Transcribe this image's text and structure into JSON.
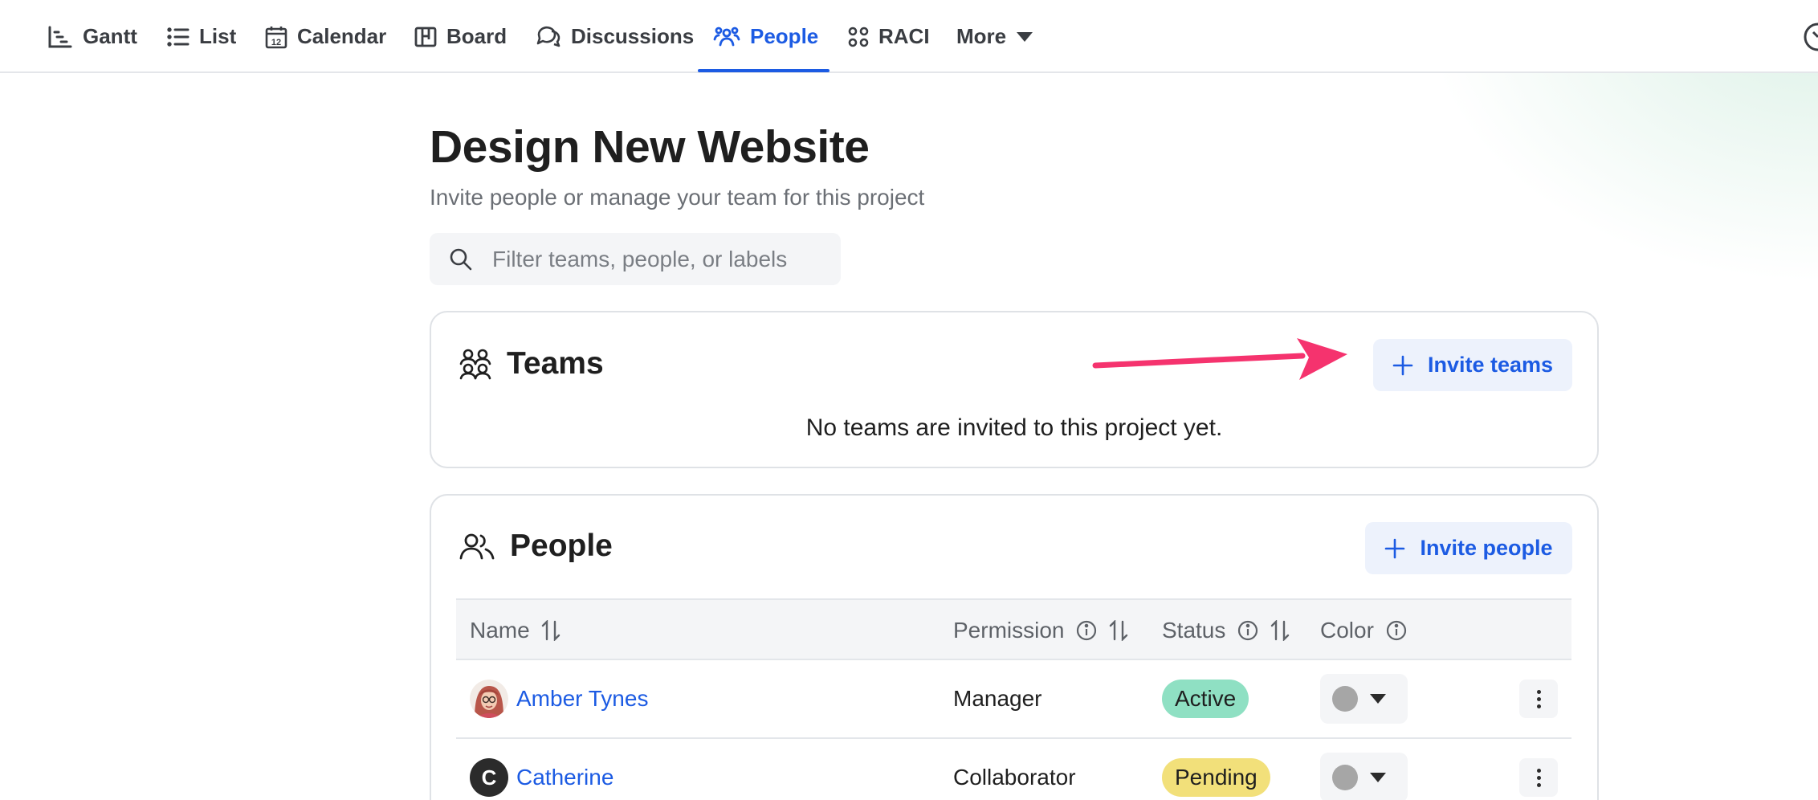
{
  "nav": {
    "items": [
      {
        "label": "Gantt",
        "icon": "gantt-icon"
      },
      {
        "label": "List",
        "icon": "list-icon"
      },
      {
        "label": "Calendar",
        "icon": "calendar-icon"
      },
      {
        "label": "Board",
        "icon": "board-icon"
      },
      {
        "label": "Discussions",
        "icon": "discussions-icon"
      },
      {
        "label": "People",
        "icon": "people-icon",
        "active": true
      },
      {
        "label": "RACI",
        "icon": "raci-icon"
      },
      {
        "label": "More",
        "icon": "caret-down-icon"
      }
    ],
    "right_icon": "timer-icon",
    "calendar_icon_day": "12"
  },
  "header": {
    "title": "Design New Website",
    "subtitle": "Invite people or manage your team for this project"
  },
  "search": {
    "placeholder": "Filter teams, people, or labels",
    "value": ""
  },
  "teams": {
    "title": "Teams",
    "invite_label": "Invite teams",
    "empty_message": "No teams are invited to this project yet.",
    "annotation": "pointing-arrow"
  },
  "people": {
    "title": "People",
    "invite_label": "Invite people",
    "columns": [
      "Name",
      "Permission",
      "Status",
      "Color"
    ],
    "rows": [
      {
        "name": "Amber Tynes",
        "avatar": "photo",
        "permission": "Manager",
        "status": "Active",
        "status_color": "#8fe0c3",
        "color": "#a6a6a6"
      },
      {
        "name": "Catherine",
        "avatar_letter": "C",
        "permission": "Collaborator",
        "status": "Pending",
        "status_color": "#f2e07a",
        "color": "#a6a6a6"
      }
    ]
  },
  "colors": {
    "accent": "#1c5be3",
    "annotation_arrow": "#f5336e"
  }
}
